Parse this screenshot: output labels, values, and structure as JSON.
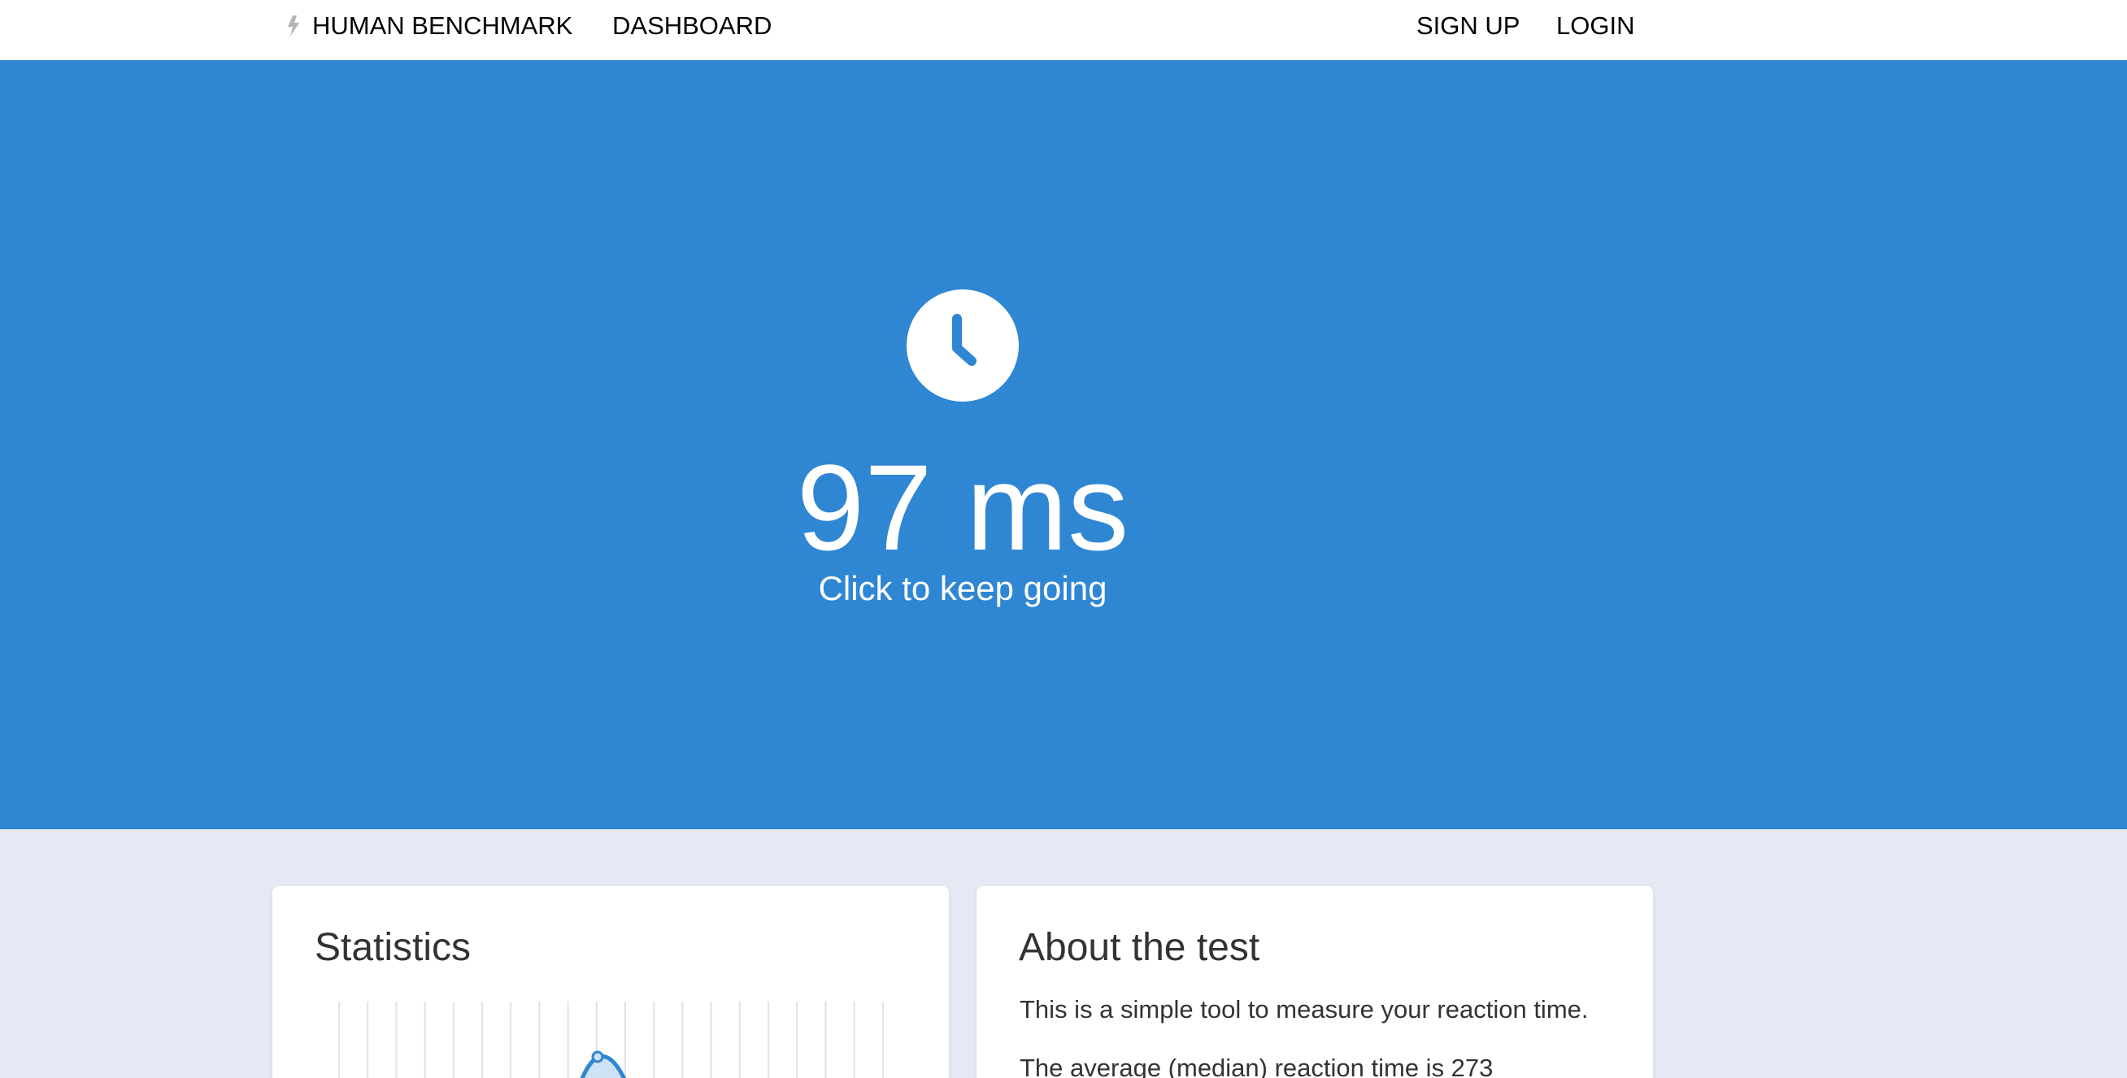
{
  "nav": {
    "brand": "HUMAN BENCHMARK",
    "dashboard": "DASHBOARD",
    "signup": "SIGN UP",
    "login": "LOGIN"
  },
  "test": {
    "result": "97 ms",
    "hint": "Click to keep going"
  },
  "stats": {
    "title": "Statistics"
  },
  "about": {
    "title": "About the test",
    "paragraphs": [
      "This is a simple tool to measure your reaction time.",
      "The average (median) reaction time is 273"
    ]
  },
  "colors": {
    "hero": "#2f86d3",
    "page_bg": "#e6e8f4",
    "card_bg": "#ffffff",
    "chart_line": "#2f86d3",
    "chart_fill": "#cfe1f4",
    "grid": "#e3e3e3"
  },
  "icons": {
    "brand": "lightning-bolt-icon",
    "test": "clock-icon"
  }
}
